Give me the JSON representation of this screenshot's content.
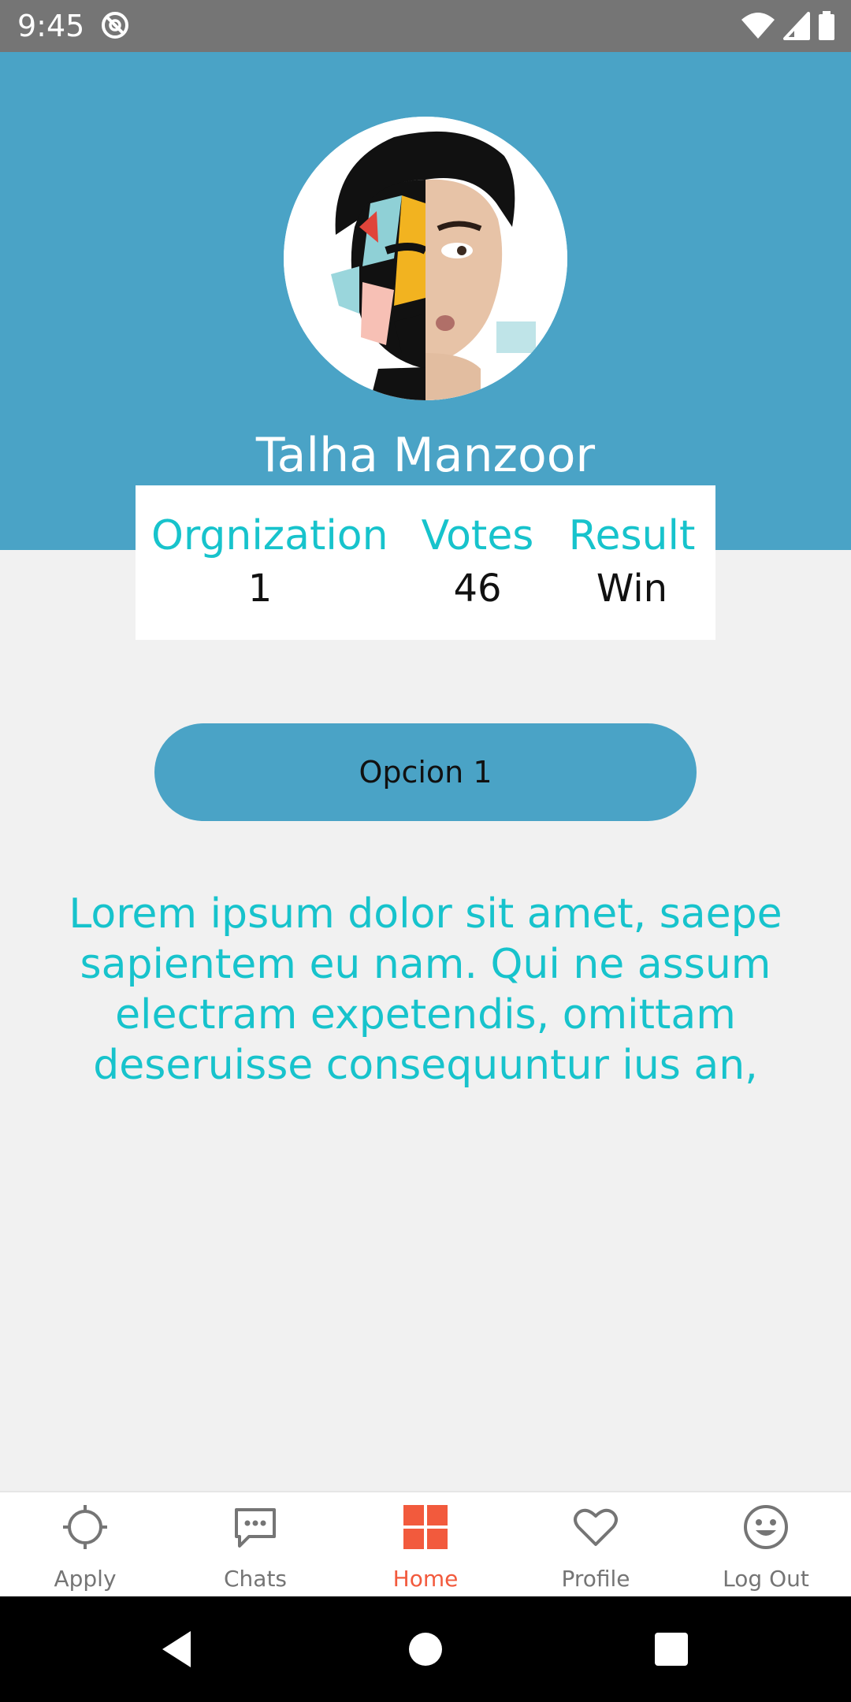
{
  "status_bar": {
    "time": "9:45",
    "icons": [
      "sync-icon",
      "wifi-icon",
      "signal-icon",
      "battery-icon"
    ]
  },
  "profile": {
    "name": "Talha Manzoor",
    "avatar": "profile-avatar-image"
  },
  "stats": {
    "organization_label": "Orgnization",
    "organization_value": "1",
    "votes_label": "Votes",
    "votes_value": "46",
    "result_label": "Result",
    "result_value": "Win"
  },
  "option_button": {
    "label": "Opcion 1"
  },
  "description": "Lorem ipsum dolor sit amet, saepe sapientem eu nam. Qui ne assum electram expetendis, omittam deseruisse consequuntur ius an,",
  "bottom_nav": {
    "items": [
      {
        "label": "Apply",
        "icon": "crosshair-icon"
      },
      {
        "label": "Chats",
        "icon": "chat-bubble-icon"
      },
      {
        "label": "Home",
        "icon": "grid-icon",
        "active": true
      },
      {
        "label": "Profile",
        "icon": "heart-icon"
      },
      {
        "label": "Log Out",
        "icon": "smiley-icon"
      }
    ]
  },
  "system_nav": {
    "buttons": [
      "back-button",
      "home-button",
      "recents-button"
    ]
  },
  "colors": {
    "header": "#4aa3c6",
    "accent_text": "#17c3cc",
    "active_nav": "#f25a3d",
    "inactive_nav": "#757575",
    "status_bar": "#757575",
    "background": "#f1f1f1"
  }
}
